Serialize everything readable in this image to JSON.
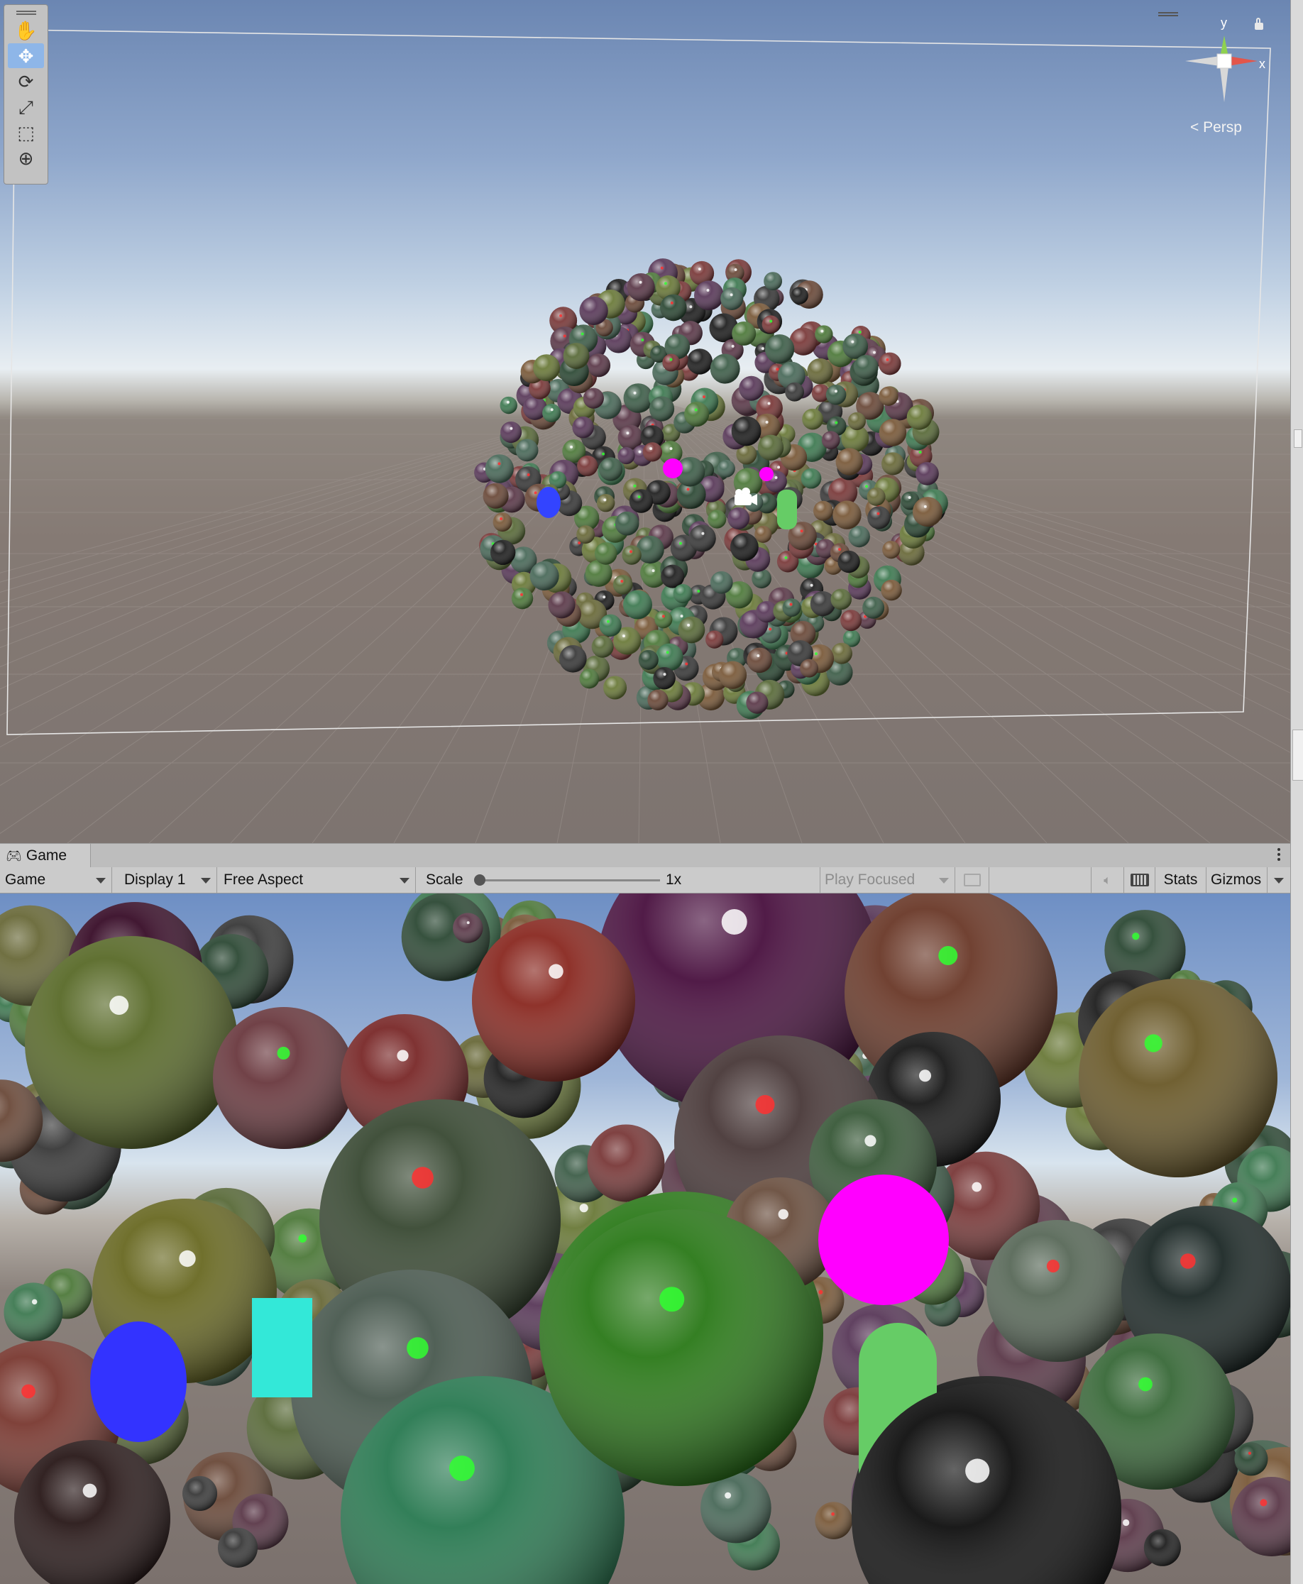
{
  "scene_view": {
    "tools": [
      {
        "name": "hand-tool",
        "glyph": "✋"
      },
      {
        "name": "move-tool",
        "glyph": "✥"
      },
      {
        "name": "rotate-tool",
        "glyph": "⟳"
      },
      {
        "name": "scale-tool",
        "glyph": "⤢"
      },
      {
        "name": "rect-tool",
        "glyph": "⬚"
      },
      {
        "name": "transform-tool",
        "glyph": "⊕"
      }
    ],
    "active_tool": "move-tool",
    "gizmo": {
      "y_label": "y",
      "x_label": "x",
      "projection": "Persp"
    }
  },
  "game_tab": {
    "label": "Game"
  },
  "toolbar": {
    "mode": "Game",
    "display": "Display 1",
    "aspect": "Free Aspect",
    "scale_label": "Scale",
    "scale_value": "1x",
    "scale_fraction": 0.0,
    "play_mode": "Play Focused",
    "stats_label": "Stats",
    "gizmos_label": "Gizmos"
  },
  "colors": {
    "accent": "#8eb6e8",
    "magenta_object": "#ff00ff",
    "blue_object": "#3333ff",
    "cyan_object": "#33e8d8",
    "green_capsule": "#66cc66"
  }
}
